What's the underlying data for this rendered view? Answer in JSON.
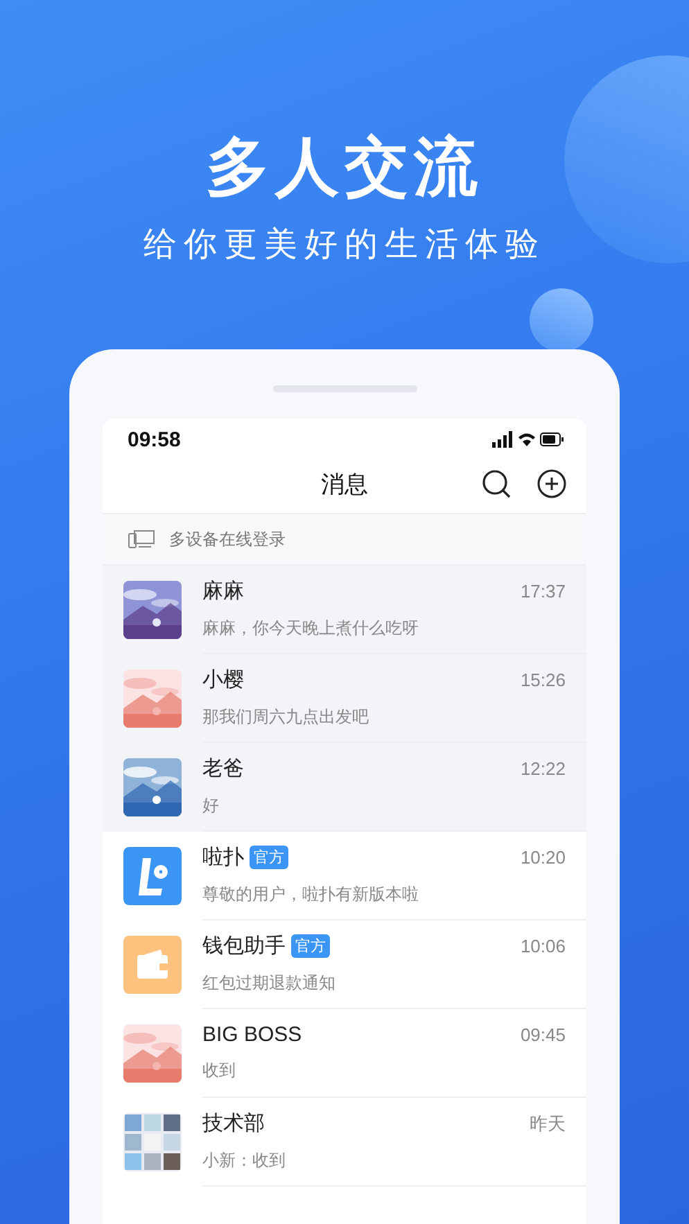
{
  "headline": "多人交流",
  "tagline": "给你更美好的生活体验",
  "status_bar": {
    "time": "09:58"
  },
  "header": {
    "title": "消息"
  },
  "device_notice": {
    "label": "多设备在线登录"
  },
  "chats": [
    {
      "name": "麻麻",
      "time": "17:37",
      "preview": "麻麻，你今天晚上煮什么吃呀",
      "pinned": true,
      "kind": "picture"
    },
    {
      "name": "小樱",
      "time": "15:26",
      "preview": "那我们周六九点出发吧",
      "pinned": true,
      "kind": "picture"
    },
    {
      "name": "老爸",
      "time": "12:22",
      "preview": "好",
      "pinned": true,
      "kind": "picture"
    },
    {
      "name": "啦扑",
      "badge": "官方",
      "time": "10:20",
      "preview": "尊敬的用户，啦扑有新版本啦",
      "pinned": false,
      "kind": "app"
    },
    {
      "name": "钱包助手",
      "badge": "官方",
      "time": "10:06",
      "preview": "红包过期退款通知",
      "pinned": false,
      "kind": "wallet"
    },
    {
      "name": "BIG BOSS",
      "time": "09:45",
      "preview": "收到",
      "pinned": false,
      "kind": "picture"
    },
    {
      "name": "技术部",
      "time": "昨天",
      "preview": "小新：收到",
      "pinned": false,
      "kind": "group"
    }
  ]
}
